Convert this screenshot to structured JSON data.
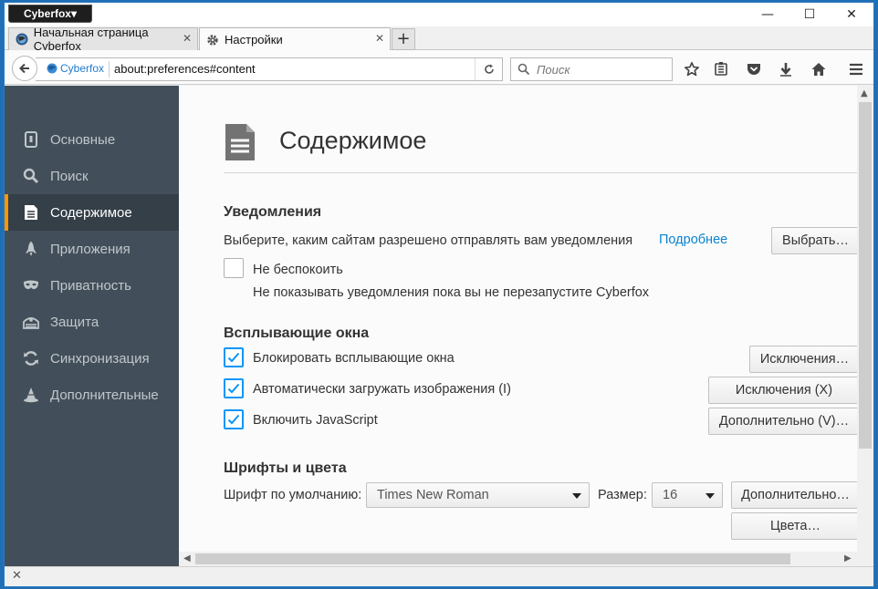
{
  "window": {
    "app_menu_label": "Cyberfox▾",
    "minimize_glyph": "—",
    "maximize_glyph": "☐",
    "close_glyph": "✕"
  },
  "tabs": [
    {
      "label": "Начальная страница Cyberfox",
      "icon": "cyberfox-globe-icon",
      "active": false
    },
    {
      "label": "Настройки",
      "icon": "gear-icon",
      "active": true
    }
  ],
  "tab_close_glyph": "✕",
  "new_tab_glyph": "+",
  "navbar": {
    "identity_label": "Cyberfox",
    "url": "about:preferences#content",
    "search_placeholder": "Поиск"
  },
  "sidebar": {
    "items": [
      {
        "label": "Основные",
        "icon": "general-icon",
        "selected": false
      },
      {
        "label": "Поиск",
        "icon": "search-icon",
        "selected": false
      },
      {
        "label": "Содержимое",
        "icon": "document-icon",
        "selected": true
      },
      {
        "label": "Приложения",
        "icon": "rocket-icon",
        "selected": false
      },
      {
        "label": "Приватность",
        "icon": "mask-icon",
        "selected": false
      },
      {
        "label": "Защита",
        "icon": "shield-icon",
        "selected": false
      },
      {
        "label": "Синхронизация",
        "icon": "sync-icon",
        "selected": false
      },
      {
        "label": "Дополнительные",
        "icon": "wizard-hat-icon",
        "selected": false
      }
    ]
  },
  "page": {
    "title": "Содержимое",
    "notifications": {
      "heading": "Уведомления",
      "description": "Выберите, каким сайтам разрешено отправлять вам уведомления",
      "learn_more": "Подробнее",
      "choose_button": "Выбрать…",
      "dnd_label": "Не беспокоить",
      "dnd_checked": false,
      "dnd_hint": "Не показывать уведомления пока вы не перезапустите Cyberfox"
    },
    "popups": {
      "heading": "Всплывающие окна",
      "block_label": "Блокировать всплывающие окна",
      "block_checked": true,
      "block_exceptions": "Исключения…",
      "images_label": "Автоматически загружать изображения (I)",
      "images_checked": true,
      "images_exceptions": "Исключения (X)",
      "js_label": "Включить JavaScript",
      "js_checked": true,
      "js_advanced": "Дополнительно (V)…"
    },
    "fonts": {
      "heading": "Шрифты и цвета",
      "default_font_label": "Шрифт по умолчанию:",
      "default_font_value": "Times New Roman",
      "size_label": "Размер:",
      "size_value": "16",
      "advanced_button": "Дополнительно…",
      "colors_button": "Цвета…"
    }
  },
  "status": {
    "close_glyph": "✕"
  },
  "colors": {
    "sidebar_bg": "#424f5a",
    "sidebar_selected": "#343f48",
    "accent_orange": "#ff9500",
    "link_blue": "#0a84d0",
    "checkbox_blue": "#0996f8"
  }
}
